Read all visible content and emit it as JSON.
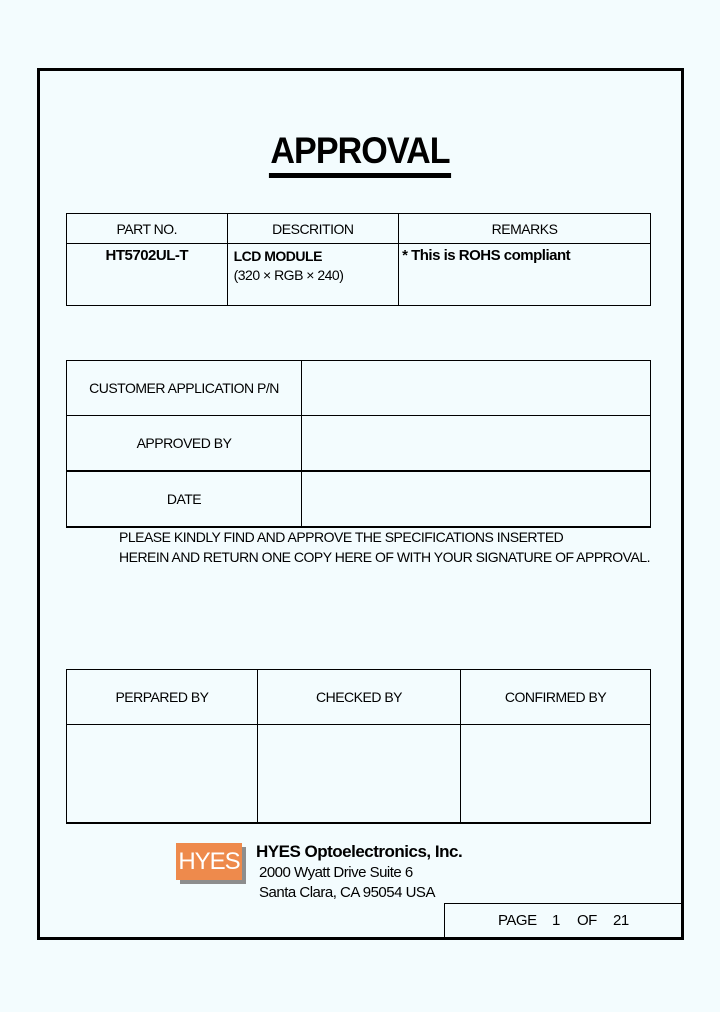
{
  "title": "APPROVAL",
  "part_table": {
    "headers": [
      "PART NO.",
      "DESCRITION",
      "REMARKS"
    ],
    "row": {
      "part_no": "HT5702UL-T",
      "description_line1": "LCD MODULE",
      "description_line2": "(320 × RGB × 240)",
      "remarks": "* This is ROHS compliant"
    }
  },
  "approval_table": {
    "rows": [
      {
        "label": "CUSTOMER APPLICATION P/N",
        "value": ""
      },
      {
        "label": "APPROVED BY",
        "value": ""
      },
      {
        "label": "DATE",
        "value": ""
      }
    ]
  },
  "note": {
    "line1": "PLEASE KINDLY FIND AND APPROVE THE SPECIFICATIONS INSERTED",
    "line2": "HEREIN AND RETURN ONE COPY HERE OF WITH YOUR SIGNATURE OF APPROVAL."
  },
  "signature_table": {
    "headers": [
      "PERPARED BY",
      "CHECKED BY",
      "CONFIRMED BY"
    ],
    "values": [
      "",
      "",
      ""
    ]
  },
  "company": {
    "logo_text": "HYES",
    "logo_color": "#ee8a4c",
    "name": "HYES Optoelectronics, Inc.",
    "address_line1": "2000 Wyatt Drive Suite 6",
    "address_line2": "Santa Clara, CA 95054 USA"
  },
  "page": {
    "label": "PAGE",
    "current": "1",
    "of_label": "OF",
    "total": "21"
  }
}
